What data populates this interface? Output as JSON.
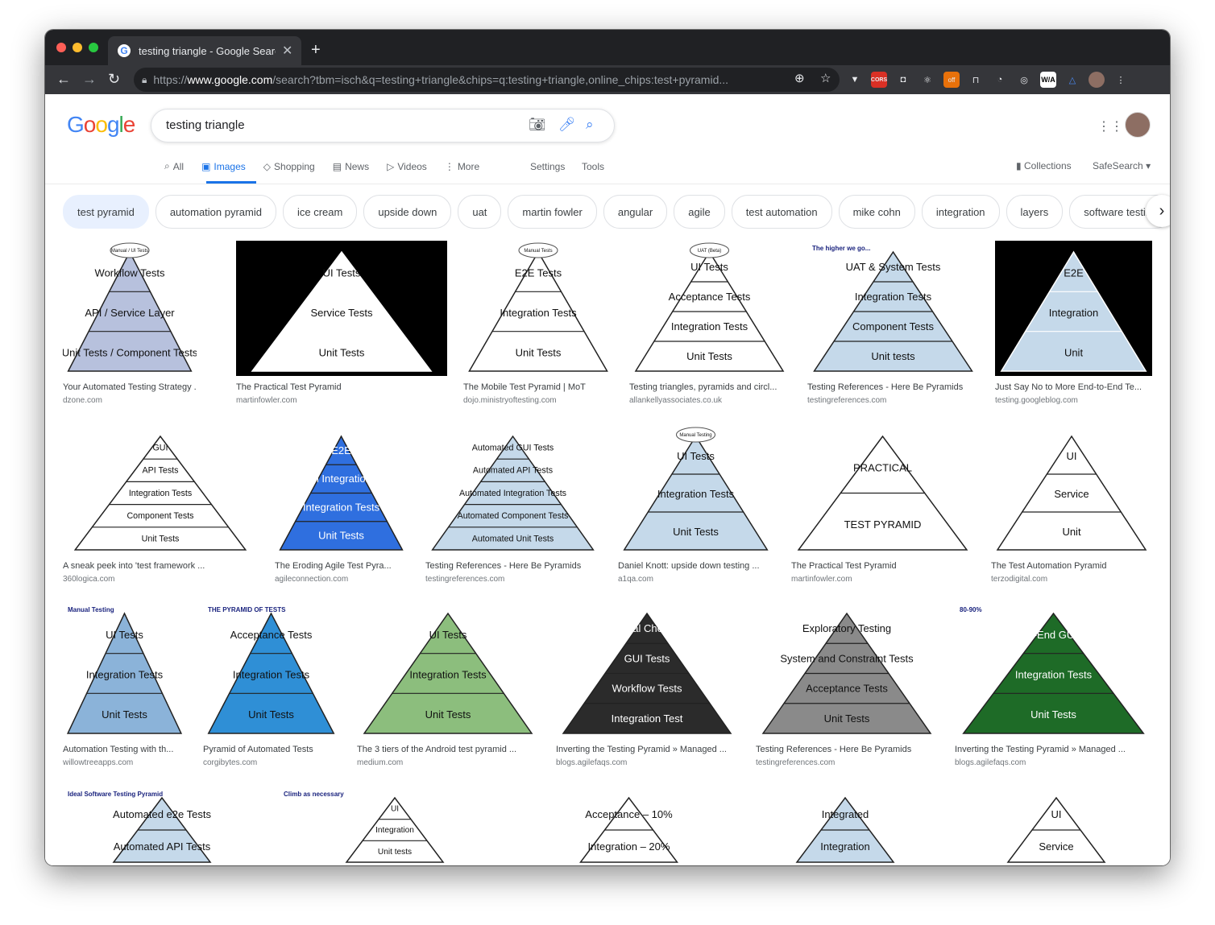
{
  "browser": {
    "tab_title": "testing triangle - Google Searc",
    "url_prefix": "https://",
    "url_host": "www.google.com",
    "url_rest": "/search?tbm=isch&q=testing+triangle&chips=q:testing+triangle,online_chips:test+pyramid...",
    "dot_colors": [
      "#ff5f57",
      "#febc2e",
      "#28c840"
    ]
  },
  "google": {
    "logo_letters": [
      {
        "l": "G",
        "c": "#4285f4"
      },
      {
        "l": "o",
        "c": "#ea4335"
      },
      {
        "l": "o",
        "c": "#fbbc05"
      },
      {
        "l": "g",
        "c": "#4285f4"
      },
      {
        "l": "l",
        "c": "#34a853"
      },
      {
        "l": "e",
        "c": "#ea4335"
      }
    ],
    "query": "testing triangle",
    "tabs": [
      {
        "label": "All",
        "icon": "search-icon"
      },
      {
        "label": "Images",
        "icon": "image-icon",
        "active": true
      },
      {
        "label": "Shopping",
        "icon": "tag-icon"
      },
      {
        "label": "News",
        "icon": "news-icon"
      },
      {
        "label": "Videos",
        "icon": "play-icon"
      },
      {
        "label": "More",
        "icon": "more-vert-icon"
      }
    ],
    "settings": "Settings",
    "tools": "Tools",
    "collections": "Collections",
    "safesearch": "SafeSearch"
  },
  "chips": [
    "test pyramid",
    "automation pyramid",
    "ice cream",
    "upside down",
    "uat",
    "martin fowler",
    "angular",
    "agile",
    "test automation",
    "mike cohn",
    "integration",
    "layers",
    "software testing"
  ],
  "results": [
    {
      "caption": "Your Automated Testing Strategy ...",
      "source": "dzone.com",
      "labels": [
        "Workflow Tests",
        "API / Service Layer",
        "Unit Tests / Component Tests"
      ],
      "cloud": "Manual / UI Tests",
      "bg": "#ffffff",
      "fill": "#b7c1dd"
    },
    {
      "caption": "The Practical Test Pyramid",
      "source": "martinfowler.com",
      "labels": [
        "UI Tests",
        "Service Tests",
        "Unit Tests"
      ],
      "bg": "#000000",
      "fill": "#ffffff"
    },
    {
      "caption": "The Mobile Test Pyramid | MoT",
      "source": "dojo.ministryoftesting.com",
      "labels": [
        "E2E Tests",
        "Integration Tests",
        "Unit Tests"
      ],
      "cloud": "Manual Tests",
      "bg": "#ffffff",
      "fill": "#ffffff"
    },
    {
      "caption": "Testing triangles, pyramids and circl...",
      "source": "allankellyassociates.co.uk",
      "labels": [
        "UI Tests",
        "Acceptance Tests",
        "Integration Tests",
        "Unit Tests"
      ],
      "cloud": "UAT (Beta)",
      "bg": "#ffffff",
      "fill": "#ffffff"
    },
    {
      "caption": "Testing References - Here Be Pyramids",
      "source": "testingreferences.com",
      "labels": [
        "UAT & System Tests",
        "Integration Tests",
        "Component Tests",
        "Unit tests"
      ],
      "note": "The higher we go...",
      "bg": "#ffffff",
      "fill": "#c5d9ea"
    },
    {
      "caption": "Just Say No to More End-to-End Te...",
      "source": "testing.googleblog.com",
      "labels": [
        "E2E",
        "Integration",
        "Unit"
      ],
      "bg": "#000000",
      "fill": "#c5d9ea"
    },
    {
      "caption": "A sneak peek into 'test framework ...",
      "source": "360logica.com",
      "labels": [
        "GUI",
        "API Tests",
        "Integration Tests",
        "Component Tests",
        "Unit Tests"
      ],
      "bg": "#ffffff",
      "fill": "#ffffff"
    },
    {
      "caption": "The Eroding Agile Test Pyra...",
      "source": "agileconnection.com",
      "labels": [
        "E2E",
        "System Integration Tests",
        "Integration Tests",
        "Unit Tests"
      ],
      "bg": "#ffffff",
      "fill": "#2f6fdf"
    },
    {
      "caption": "Testing References - Here Be Pyramids",
      "source": "testingreferences.com",
      "labels": [
        "Automated GUI Tests",
        "Automated API Tests",
        "Automated Integration Tests",
        "Automated Component Tests",
        "Automated Unit Tests"
      ],
      "bg": "#ffffff",
      "fill": "#c5d9ea"
    },
    {
      "caption": "Daniel Knott: upside down testing ...",
      "source": "a1qa.com",
      "labels": [
        "UI Tests",
        "Integration Tests",
        "Unit Tests"
      ],
      "cloud": "Manual Testing",
      "bg": "#ffffff",
      "fill": "#c5d9ea"
    },
    {
      "caption": "The Practical Test Pyramid",
      "source": "martinfowler.com",
      "labels": [
        "PRACTICAL",
        "TEST PYRAMID"
      ],
      "bg": "#ffffff",
      "fill": "#ffffff"
    },
    {
      "caption": "The Test Automation Pyramid",
      "source": "terzodigital.com",
      "labels": [
        "UI",
        "Service",
        "Unit"
      ],
      "bg": "#ffffff",
      "fill": "#ffffff"
    },
    {
      "caption": "Automation Testing with th...",
      "source": "willowtreeapps.com",
      "labels": [
        "UI Tests",
        "Integration Tests",
        "Unit Tests"
      ],
      "note": "Manual Testing",
      "bg": "#ffffff",
      "fill": "#8bb3d9"
    },
    {
      "caption": "Pyramid of Automated Tests",
      "source": "corgibytes.com",
      "labels": [
        "Acceptance Tests",
        "Integration Tests",
        "Unit Tests"
      ],
      "note": "THE PYRAMID OF TESTS",
      "bg": "#ffffff",
      "fill": "#2f8fd6"
    },
    {
      "caption": "The 3 tiers of the Android test pyramid ...",
      "source": "medium.com",
      "labels": [
        "UI Tests",
        "Integration Tests",
        "Unit Tests"
      ],
      "bg": "#ffffff",
      "fill": "#8cbe7d"
    },
    {
      "caption": "Inverting the Testing Pyramid » Managed ...",
      "source": "blogs.agilefaqs.com",
      "labels": [
        "Manual Checking",
        "GUI Tests",
        "Workflow Tests",
        "Integration Test"
      ],
      "bg": "#ffffff",
      "fill": "#2b2b2b"
    },
    {
      "caption": "Testing References - Here Be Pyramids",
      "source": "testingreferences.com",
      "labels": [
        "Exploratory Testing",
        "System and Constraint Tests",
        "Acceptance Tests",
        "Unit Tests"
      ],
      "bg": "#ffffff",
      "fill": "#8a8a8a"
    },
    {
      "caption": "Inverting the Testing Pyramid » Managed ...",
      "source": "blogs.agilefaqs.com",
      "labels": [
        "End-to-End GUI Tests",
        "Integration Tests",
        "Unit Tests"
      ],
      "note": "80-90%",
      "bg": "#ffffff",
      "fill": "#1e6b27"
    },
    {
      "caption": "",
      "source": "",
      "labels": [
        "Automated e2e Tests",
        "Automated API Tests"
      ],
      "note": "Ideal Software Testing Pyramid",
      "bg": "#ffffff",
      "fill": "#c5d9ea"
    },
    {
      "caption": "",
      "source": "",
      "labels": [
        "UI",
        "Integration",
        "Unit tests"
      ],
      "note": "Climb as necessary",
      "bg": "#ffffff",
      "fill": "#ffffff"
    },
    {
      "caption": "",
      "source": "",
      "labels": [
        "Acceptance – 10%",
        "Integration – 20%"
      ],
      "bg": "#ffffff",
      "fill": "#ffffff"
    },
    {
      "caption": "",
      "source": "",
      "labels": [
        "Integrated",
        "Integration"
      ],
      "bg": "#ffffff",
      "fill": "#c5d9ea"
    },
    {
      "caption": "",
      "source": "",
      "labels": [
        "UI",
        "Service"
      ],
      "bg": "#ffffff",
      "fill": "#ffffff"
    }
  ]
}
